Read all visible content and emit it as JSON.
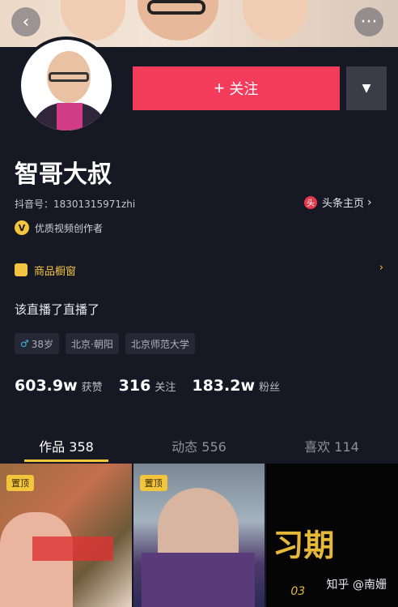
{
  "header": {
    "back_icon": "chevron-left-icon",
    "more_icon": "more-dots-icon"
  },
  "profile": {
    "follow_label": "关注",
    "follow_plus": "+",
    "dropdown_icon": "triangle-down-icon",
    "name": "智哥大叔",
    "douyin_id": "抖音号：18301315971zhi",
    "toutiao_label": "头条主页",
    "toutiao_chevron": "›",
    "creator_label": "优质视频创作者",
    "creator_icon": "V",
    "window_label": "商品橱窗",
    "window_chevron": "›",
    "signature": "该直播了直播了",
    "tags": {
      "age_gender": "38岁",
      "gender_symbol": "♂",
      "location": "北京·朝阳",
      "school": "北京师范大学"
    },
    "stats": {
      "likes_num": "603.9w",
      "likes_label": "获赞",
      "following_num": "316",
      "following_label": "关注",
      "followers_num": "183.2w",
      "followers_label": "粉丝"
    }
  },
  "tabs": [
    {
      "label": "作品 358",
      "active": true
    },
    {
      "label": "动态 556",
      "active": false
    },
    {
      "label": "喜欢 114",
      "active": false
    }
  ],
  "grid": {
    "badge_1": "置顶",
    "badge_2": "置顶",
    "cell_3_title": "习期",
    "cell_3_sub": "03"
  },
  "watermark": "知乎 @南姗",
  "colors": {
    "background": "#161824",
    "follow_button": "#f33b5c",
    "accent_yellow": "#f3c53c"
  }
}
